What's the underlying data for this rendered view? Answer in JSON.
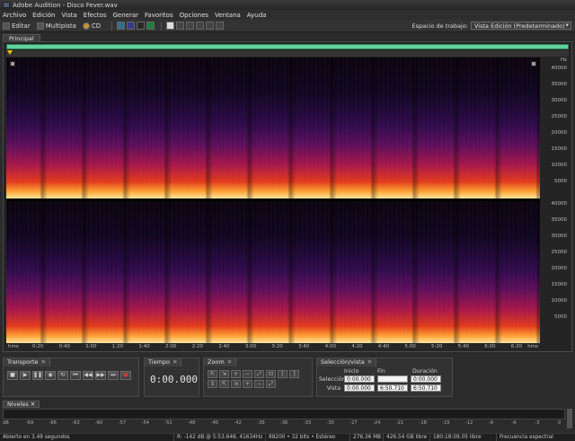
{
  "window": {
    "title": "Adobe Audition - Disco Fever.wav"
  },
  "menu": [
    "Archivo",
    "Edición",
    "Vista",
    "Efectos",
    "Generar",
    "Favoritos",
    "Opciones",
    "Ventana",
    "Ayuda"
  ],
  "toolbar": {
    "edit_label": "Editar",
    "multitrack_label": "Multipista",
    "cd_label": "CD",
    "workspace_label": "Espacio de trabajo:",
    "workspace_value": "Vista Edición (Predeterminado)"
  },
  "main_tab": "Principal",
  "hz_axis": {
    "unit": "Hz",
    "ch1": [
      "40000",
      "35000",
      "30000",
      "25000",
      "20000",
      "15000",
      "10000",
      "5000"
    ],
    "ch2": [
      "40000",
      "35000",
      "30000",
      "25000",
      "20000",
      "15000",
      "10000",
      "5000"
    ]
  },
  "time_axis": {
    "start": "hms",
    "end": "hms",
    "ticks": [
      "0:20",
      "0:40",
      "1:00",
      "1:20",
      "1:40",
      "2:00",
      "2:20",
      "2:40",
      "3:00",
      "3:20",
      "3:40",
      "4:00",
      "4:20",
      "4:40",
      "5:00",
      "5:20",
      "5:40",
      "6:00",
      "6:20"
    ]
  },
  "transport": {
    "title": "Transporte"
  },
  "time_panel": {
    "title": "Tiempo",
    "value": "0:00.000"
  },
  "zoom_panel": {
    "title": "Zoom"
  },
  "selection_panel": {
    "title": "Selección/vista",
    "headers": {
      "start": "Inicio",
      "end": "Fin",
      "duration": "Duración"
    },
    "rows": [
      {
        "label": "Selección",
        "start": "0:00.000",
        "end": "",
        "duration": "0:00.000"
      },
      {
        "label": "Vista",
        "start": "0:00.000",
        "end": "6:50.710",
        "duration": "6:50.710"
      }
    ]
  },
  "levels": {
    "title": "Niveles",
    "scale": [
      "dB",
      "-69",
      "-66",
      "-63",
      "-60",
      "-57",
      "-54",
      "-51",
      "-48",
      "-45",
      "-42",
      "-39",
      "-36",
      "-33",
      "-30",
      "-27",
      "-24",
      "-21",
      "-18",
      "-15",
      "-12",
      "-9",
      "-6",
      "-3",
      "0"
    ]
  },
  "status": {
    "opened": "Abierto en 3.49 segundos",
    "cursor": "R: -142 dB @ 5:53.648, 41634Hz",
    "format": "88200 • 32 bits • Estéreo",
    "size": "276.36 MB",
    "free": "426.54 GB libre",
    "time_free": "180:18:09.05 libre",
    "view": "Frecuencia espectral"
  }
}
